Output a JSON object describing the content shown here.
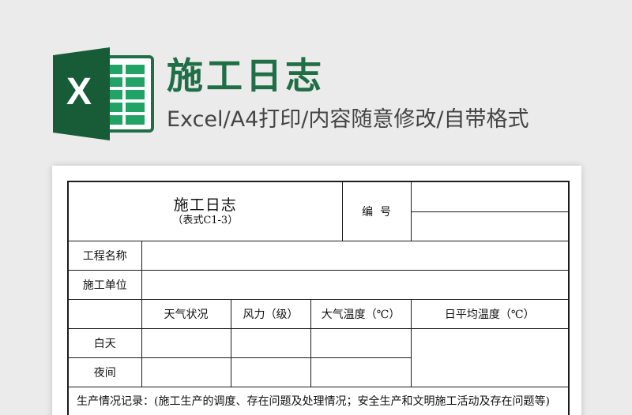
{
  "banner": {
    "logo_letter": "X",
    "title": "施工日志",
    "subtitle": "Excel/A4打印/内容随意修改/自带格式",
    "colors": {
      "brand_green": "#1f6e45",
      "logo_dark": "#185c37",
      "logo_light": "#21a366"
    }
  },
  "form": {
    "title": "施工日志",
    "code": "（表式C1-3）",
    "number_label": "编  号",
    "project_name_label": "工程名称",
    "construction_unit_label": "施工单位",
    "weather_headers": [
      "天气状况",
      "风力（级）",
      "大气温度（℃）",
      "日平均温度（℃）"
    ],
    "rows": [
      {
        "label": "白天"
      },
      {
        "label": "夜间"
      }
    ],
    "notes": "生产情况记录：(施工生产的调度、存在问题及处理情况；安全生产和文明施工活动及存在问题等)"
  }
}
